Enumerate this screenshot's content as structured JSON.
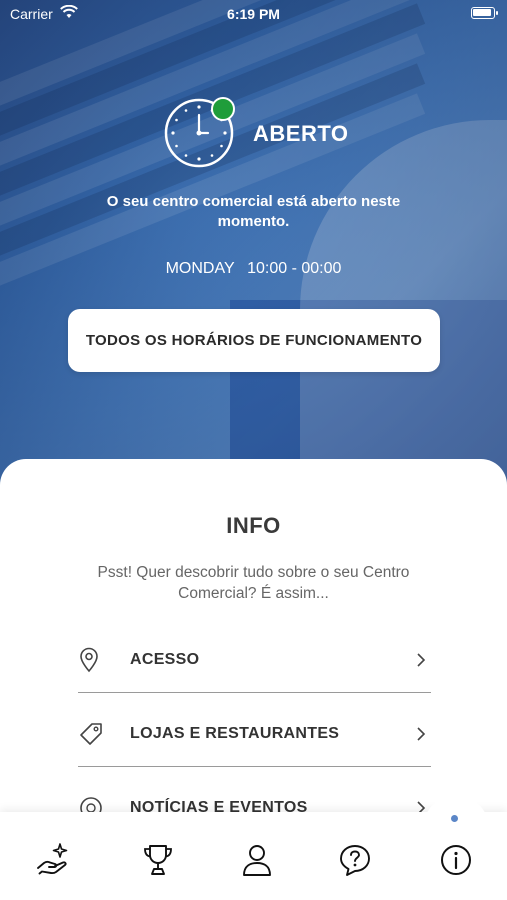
{
  "status_bar": {
    "carrier": "Carrier",
    "time": "6:19 PM"
  },
  "open_status": {
    "label": "ABERTO",
    "description": "O seu centro comercial está aberto neste momento.",
    "day": "MONDAY",
    "hours": "10:00 - 00:00",
    "status_color": "#1f9d3a"
  },
  "all_hours_button": {
    "label": "TODOS OS HORÁRIOS DE FUNCIONAMENTO"
  },
  "info": {
    "title": "INFO",
    "subtitle": "Psst! Quer descobrir tudo sobre o seu Centro Comercial? É assim...",
    "items": [
      {
        "label": "ACESSO",
        "icon": "map-pin-icon"
      },
      {
        "label": "LOJAS E RESTAURANTES",
        "icon": "tag-icon"
      },
      {
        "label": "NOTÍCIAS E EVENTOS",
        "icon": "news-icon"
      }
    ]
  },
  "tab_bar": {
    "tabs": [
      {
        "icon": "hand-sparkle-icon"
      },
      {
        "icon": "trophy-icon"
      },
      {
        "icon": "user-icon"
      },
      {
        "icon": "help-icon"
      },
      {
        "icon": "info-icon",
        "active": true
      }
    ],
    "accent": "#5b86c7"
  }
}
